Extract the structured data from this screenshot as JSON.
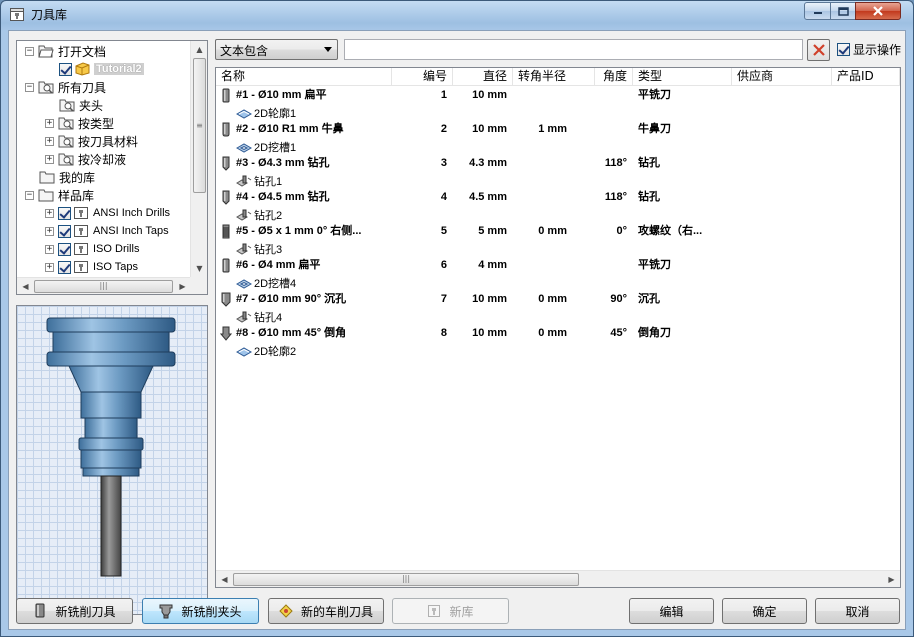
{
  "window": {
    "title": "刀具库"
  },
  "tree": {
    "items": [
      {
        "label": "打开文档",
        "level": 0,
        "expander": "−",
        "icon": "open-folder-icon"
      },
      {
        "label": "Tutorial2",
        "level": 1,
        "checked": true,
        "icon": "document-cube-icon",
        "selected": true
      },
      {
        "label": "所有刀具",
        "level": 0,
        "expander": "−",
        "icon": "folder-search-icon"
      },
      {
        "label": "夹头",
        "level": 1,
        "icon": "folder-search-icon"
      },
      {
        "label": "按类型",
        "level": 1,
        "expander": "+",
        "icon": "folder-search-icon"
      },
      {
        "label": "按刀具材料",
        "level": 1,
        "expander": "+",
        "icon": "folder-search-icon"
      },
      {
        "label": "按冷却液",
        "level": 1,
        "expander": "+",
        "icon": "folder-search-icon"
      },
      {
        "label": "我的库",
        "level": 0,
        "icon": "folder-icon"
      },
      {
        "label": "样品库",
        "level": 0,
        "expander": "−",
        "icon": "folder-icon"
      },
      {
        "label": "ANSI Inch Drills",
        "level": 1,
        "expander": "+",
        "checked": true,
        "icon": "library-icon"
      },
      {
        "label": "ANSI Inch Taps",
        "level": 1,
        "expander": "+",
        "checked": true,
        "icon": "library-icon"
      },
      {
        "label": "ISO Drills",
        "level": 1,
        "expander": "+",
        "checked": true,
        "icon": "library-icon"
      },
      {
        "label": "ISO Taps",
        "level": 1,
        "expander": "+",
        "checked": true,
        "icon": "library-icon"
      }
    ]
  },
  "filter": {
    "selected": "文本包含",
    "search_value": "",
    "show_ops_label": "显示操作",
    "show_ops_checked": true
  },
  "table": {
    "columns": [
      "名称",
      "编号",
      "直径",
      "转角半径",
      "角度",
      "类型",
      "供应商",
      "产品ID"
    ],
    "rows": [
      {
        "icon": "flat-mill-icon",
        "name": "#1 - Ø10 mm 扁平",
        "number": "1",
        "diameter": "10 mm",
        "corner": "",
        "angle": "",
        "type": "平铣刀",
        "op_icon": "contour-op-icon",
        "op": "2D轮廓1"
      },
      {
        "icon": "bull-nose-icon",
        "name": "#2 - Ø10 R1 mm 牛鼻",
        "number": "2",
        "diameter": "10 mm",
        "corner": "1 mm",
        "angle": "",
        "type": "牛鼻刀",
        "op_icon": "pocket-op-icon",
        "op": "2D挖槽1"
      },
      {
        "icon": "drill-icon",
        "name": "#3 - Ø4.3 mm 钻孔",
        "number": "3",
        "diameter": "4.3 mm",
        "corner": "",
        "angle": "118°",
        "type": "钻孔",
        "op_icon": "drill-op-icon",
        "op": "钻孔1"
      },
      {
        "icon": "drill-icon",
        "name": "#4 - Ø4.5 mm 钻孔",
        "number": "4",
        "diameter": "4.5 mm",
        "corner": "",
        "angle": "118°",
        "type": "钻孔",
        "op_icon": "drill-op-icon",
        "op": "钻孔2"
      },
      {
        "icon": "tap-icon",
        "name": "#5 - Ø5 x 1 mm 0° 右侧...",
        "number": "5",
        "diameter": "5 mm",
        "corner": "0 mm",
        "angle": "0°",
        "type": "攻螺纹（右...",
        "op_icon": "drill-op-icon",
        "op": "钻孔3"
      },
      {
        "icon": "flat-mill-icon",
        "name": "#6 - Ø4 mm 扁平",
        "number": "6",
        "diameter": "4 mm",
        "corner": "",
        "angle": "",
        "type": "平铣刀",
        "op_icon": "pocket-op-icon",
        "op": "2D挖槽4"
      },
      {
        "icon": "countersink-icon",
        "name": "#7 - Ø10 mm 90° 沉孔",
        "number": "7",
        "diameter": "10 mm",
        "corner": "0 mm",
        "angle": "90°",
        "type": "沉孔",
        "op_icon": "drill-op-icon",
        "op": "钻孔4"
      },
      {
        "icon": "chamfer-icon",
        "name": "#8 - Ø10 mm 45° 倒角",
        "number": "8",
        "diameter": "10 mm",
        "corner": "0 mm",
        "angle": "45°",
        "type": "倒角刀",
        "op_icon": "contour-op-icon",
        "op": "2D轮廓2"
      }
    ]
  },
  "buttons": {
    "new_mill_tool": "新铣削刀具",
    "new_mill_holder": "新铣削夹头",
    "new_turn_tool": "新的车削刀具",
    "new_library": "新库",
    "edit": "编辑",
    "ok": "确定",
    "cancel": "取消"
  },
  "colors": {
    "selection_accent": "#3c7fb1",
    "tool_preview": "#6d9bc3"
  }
}
